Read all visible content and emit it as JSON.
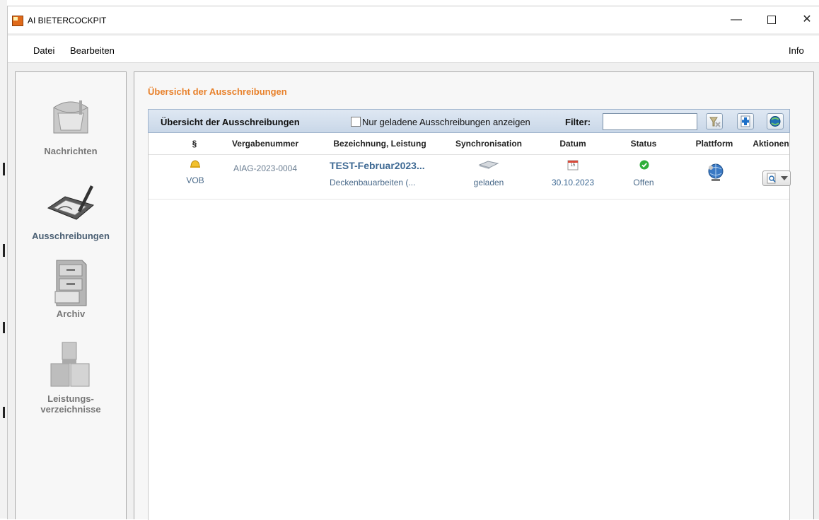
{
  "window": {
    "title": "AI BIETERCOCKPIT",
    "minimize": "—",
    "close": "✕"
  },
  "menu": {
    "datei": "Datei",
    "bearbeiten": "Bearbeiten",
    "info": "Info"
  },
  "sidebar": {
    "items": [
      {
        "label": "Nachrichten",
        "icon": "mailbox-icon",
        "active": false
      },
      {
        "label": "Ausschreibungen",
        "icon": "tablet-pen-icon",
        "active": true
      },
      {
        "label": "Archiv",
        "icon": "file-cabinet-icon",
        "active": false
      },
      {
        "label": "Leistungs-",
        "label2": "verzeichnisse",
        "icon": "boxes-icon",
        "active": false
      }
    ]
  },
  "main": {
    "page_title": "Übersicht der Ausschreibungen",
    "toolbar": {
      "title": "Übersicht der Ausschreibungen",
      "checkbox_label": "Nur geladene Ausschreibungen anzeigen",
      "checkbox_checked": false,
      "filter_label": "Filter:",
      "filter_value": ""
    },
    "columns": [
      "§",
      "Vergabenummer",
      "Bezeichnung, Leistung",
      "Synchronisation",
      "Datum",
      "Status",
      "Plattform",
      "Aktionen"
    ],
    "rows": [
      {
        "para": "VOB",
        "vergabenummer": "AIAG-2023-0004",
        "title": "TEST-Februar2023...",
        "leistung": "Deckenbauarbeiten (...",
        "sync": "geladen",
        "datum": "30.10.2023",
        "calendar_day": "15",
        "status": "Offen"
      }
    ]
  },
  "colors": {
    "accent_orange": "#e8812b",
    "link_blue": "#3f6a94",
    "status_green": "#2fae3a"
  }
}
